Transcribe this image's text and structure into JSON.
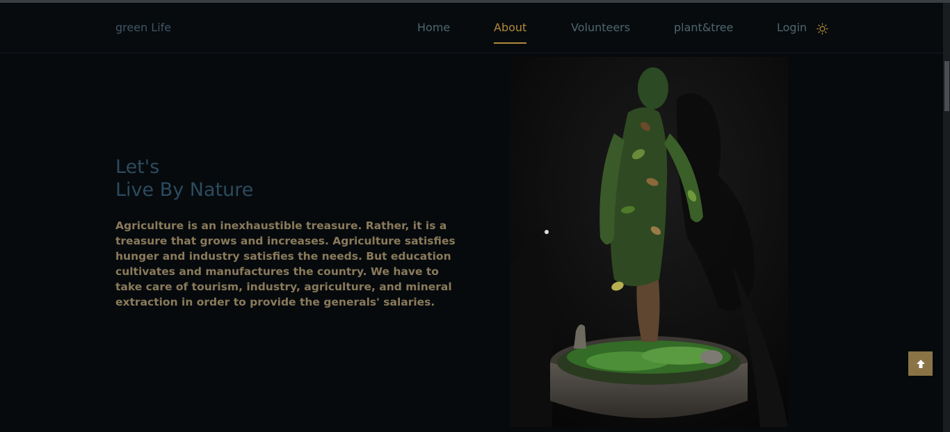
{
  "brand": "green Life",
  "nav": {
    "items": [
      {
        "label": "Home",
        "active": false
      },
      {
        "label": "About",
        "active": true
      },
      {
        "label": "Volunteers",
        "active": false
      },
      {
        "label": "plant&tree",
        "active": false
      },
      {
        "label": "Login",
        "active": false
      }
    ],
    "theme_toggle_icon": "sun-icon"
  },
  "hero": {
    "title_line1": "Let's",
    "title_line2": "Live By Nature",
    "body": "Agriculture is an inexhaustible treasure. Rather, it is a treasure that grows and increases. Agriculture satisfies hunger and industry satisfies the needs. But education cultivates and manufactures the country. We have to take care of tourism, industry, agriculture, and mineral extraction in order to provide the generals' salaries."
  },
  "scroll_top_icon": "arrow-up-icon",
  "colors": {
    "accent": "#b38a3a",
    "background": "#060a0d",
    "title": "#2c4b5e",
    "body_text": "#8a7a5a"
  }
}
